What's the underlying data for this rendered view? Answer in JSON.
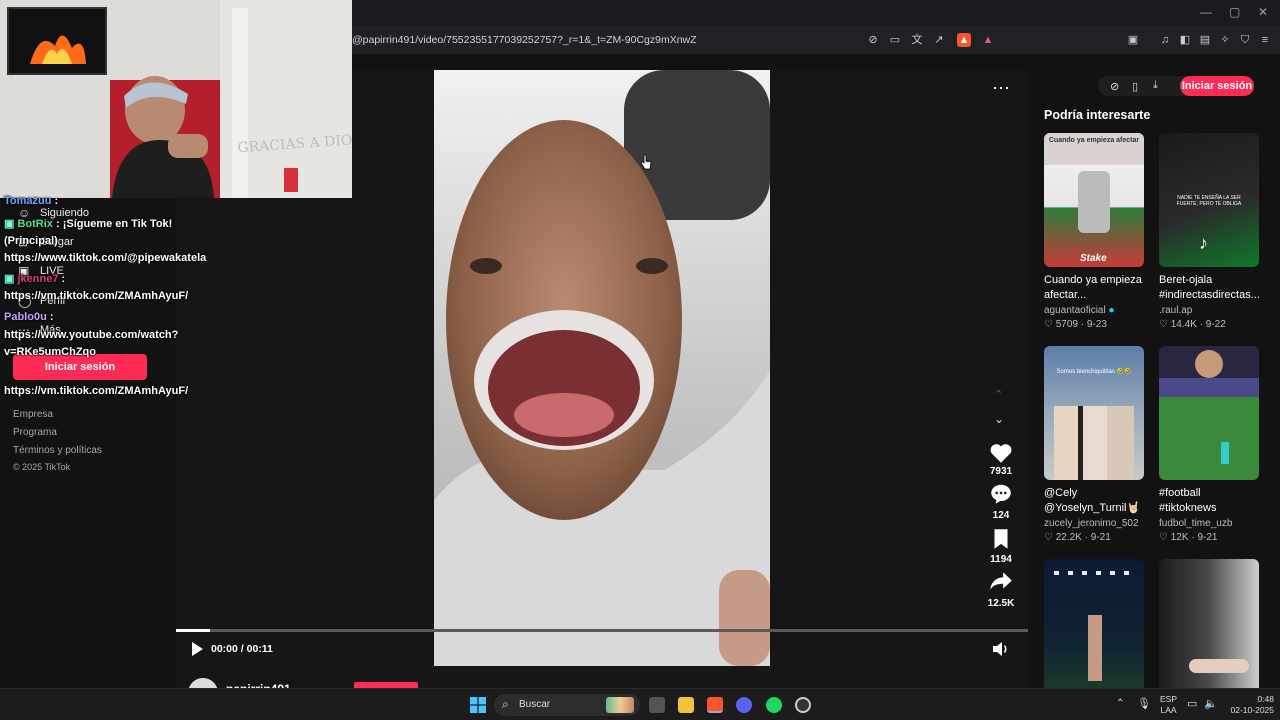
{
  "browser": {
    "url": "@papirrin491/video/7552355177039252757?_r=1&_t=ZM-90Cgz9mXnwZ",
    "window_controls": [
      "—",
      "▢",
      "✕"
    ]
  },
  "left_nav": {
    "items": [
      "Siguiendo",
      "Cargar",
      "LIVE",
      "Perfil",
      "Más"
    ],
    "signin_label": "Iniciar sesión",
    "footer": [
      "Empresa",
      "Programa",
      "Términos y políticas",
      "© 2025 TikTok"
    ]
  },
  "stream_overlay": {
    "chat": [
      {
        "user": "Tomazuu",
        "text": ":"
      },
      {
        "user": "BotRix",
        "text": ": ¡Sígueme en Tik Tok!"
      },
      {
        "user": "",
        "text": "(Principal)"
      },
      {
        "user": "",
        "text": "https://www.tiktok.com/@pipewakatela"
      },
      {
        "user": "jkenne7",
        "text": ":"
      },
      {
        "user": "",
        "text": "https://vm.tiktok.com/ZMAmhAyuF/"
      },
      {
        "user": "Pablo0u",
        "text": ":"
      },
      {
        "user": "",
        "text": "https://www.youtube.com/watch?"
      },
      {
        "user": "",
        "text": "v=RKe5umChZqo"
      },
      {
        "user": "",
        "text": "https://vm.tiktok.com/ZMAmhAyuF/"
      }
    ],
    "wall_text": "GRACIAS A DIOS"
  },
  "player": {
    "more_label": "⋯",
    "likes": "7931",
    "comments": "124",
    "saves": "1194",
    "shares": "12.5K",
    "time": "00:00 / 00:11",
    "progress": 0.04,
    "author_partial": "papirrin491"
  },
  "right_rail": {
    "signin_label": "Iniciar sesión",
    "heading": "Podría interesarte",
    "cards": [
      {
        "title": "Cuando ya empieza afectar...",
        "author": "aguantaoficial",
        "verified": true,
        "likes": "5709",
        "date": "9-23",
        "overlay": "Cuando ya empieza afectar",
        "brand": "Stake"
      },
      {
        "title": "Beret-ojala #indirectasdirectas...",
        "author": ".raul.ap",
        "verified": false,
        "likes": "14.4K",
        "date": "9-22",
        "overlay": "NADIE TE ENSEÑA LA SER FUERTE, PERO TE OBLIGA"
      },
      {
        "title": "@Cely @Yoselyn_Turnil🤘🏻",
        "author": "zucely_jeronimo_502",
        "verified": false,
        "likes": "22.2K",
        "date": "9-21",
        "overlay": "Somos bienchiquititas 🤣🤣"
      },
      {
        "title": "#football #tiktoknews #tiktokshop...",
        "author": "fudbol_time_uzb",
        "verified": false,
        "likes": "12K",
        "date": "9-21"
      },
      {
        "title": "",
        "author": "",
        "likes": "",
        "date": ""
      },
      {
        "title": "",
        "author": "",
        "likes": "",
        "date": ""
      }
    ]
  },
  "taskbar": {
    "search_label": "Buscar",
    "lang": "ESP",
    "lang2": "LAA",
    "time": "0:48",
    "date": "02-10-2025"
  },
  "colors": {
    "accent": "#fe2c55",
    "bg": "#121212",
    "browser": "#202124"
  }
}
